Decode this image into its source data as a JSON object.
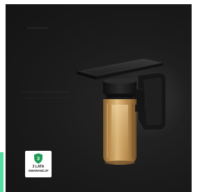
{
  "image": {
    "subject": "wall-lamp-photo",
    "background_color": "#161616",
    "accent_color": "#52e0a0"
  },
  "badge": {
    "icon": "shield-check-icon",
    "icon_number": "3",
    "line1": "3 LATA",
    "line2": "GWARANCJI*",
    "icon_color": "#1f9d57"
  }
}
